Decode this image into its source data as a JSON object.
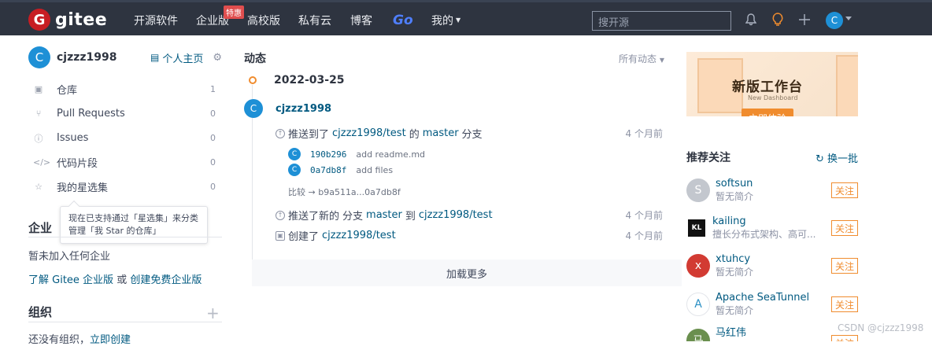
{
  "topbar": {
    "logo_letter": "G",
    "logo_text": "gitee",
    "nav": [
      "开源软件",
      "企业版",
      "高校版",
      "私有云",
      "博客"
    ],
    "hot_badge": "特惠",
    "go": "Go",
    "mine": "我的",
    "search_placeholder": "搜开源",
    "avatar_letter": "C"
  },
  "profile": {
    "avatar_letter": "C",
    "username": "cjzzz1998",
    "home_label": "个人主页"
  },
  "menu": [
    {
      "label": "仓库",
      "count": "1"
    },
    {
      "label": "Pull Requests",
      "count": "0"
    },
    {
      "label": "Issues",
      "count": "0"
    },
    {
      "label": "代码片段",
      "count": "0"
    },
    {
      "label": "我的星选集",
      "count": "0"
    }
  ],
  "tooltip": "现在已支持通过「星选集」来分类管理「我 Star 的仓库」",
  "enterprise": {
    "title": "企业",
    "empty": "暂未加入任何企业",
    "learn": "了解 Gitee 企业版",
    "or": "或",
    "create": "创建免费企业版"
  },
  "orgs": {
    "title": "组织",
    "empty": "还没有组织，",
    "create": "立即创建"
  },
  "feed": {
    "title": "动态",
    "filter": "所有动态",
    "date": "2022-03-25",
    "user_avatar": "C",
    "user": "cjzzz1998",
    "push1": {
      "prefix": "推送到了",
      "repo": "cjzzz1998/test",
      "mid": "的",
      "branch": "master",
      "suffix": "分支",
      "time": "4 个月前"
    },
    "commits": [
      {
        "avatar": "C",
        "sha": "190b296",
        "msg": "add readme.md"
      },
      {
        "avatar": "C",
        "sha": "0a7db8f",
        "msg": "add files"
      }
    ],
    "compare_label": "比较 →",
    "compare_range": "b9a511a...0a7db8f",
    "push2": {
      "prefix": "推送了新的",
      "kind": "分支",
      "branch": "master",
      "mid": "到",
      "repo": "cjzzz1998/test",
      "time": "4 个月前"
    },
    "create": {
      "prefix": "创建了",
      "repo": "cjzzz1998/test",
      "time": "4 个月前"
    },
    "load_more": "加载更多"
  },
  "banner": {
    "title": "新版工作台",
    "subtitle": "New Dashboard",
    "button": "立即体验"
  },
  "recommend": {
    "title": "推荐关注",
    "swap": "换一批",
    "follow_label": "关注",
    "users": [
      {
        "name": "softsun",
        "desc": "暂无简介",
        "avatar": "S",
        "color": "#c3c7ce"
      },
      {
        "name": "kailing",
        "desc": "擅长分布式架构、高可...",
        "avatar": "KL",
        "color": "#111111"
      },
      {
        "name": "xtuhcy",
        "desc": "暂无简介",
        "avatar": "x",
        "color": "#d23b33"
      },
      {
        "name": "Apache SeaTunnel",
        "desc": "暂无简介",
        "avatar": "A",
        "color": "#ffffff"
      },
      {
        "name": "马红伟",
        "desc": "",
        "avatar": "马",
        "color": "#6a8f4e"
      }
    ]
  },
  "watermark": "CSDN @cjzzz1998"
}
